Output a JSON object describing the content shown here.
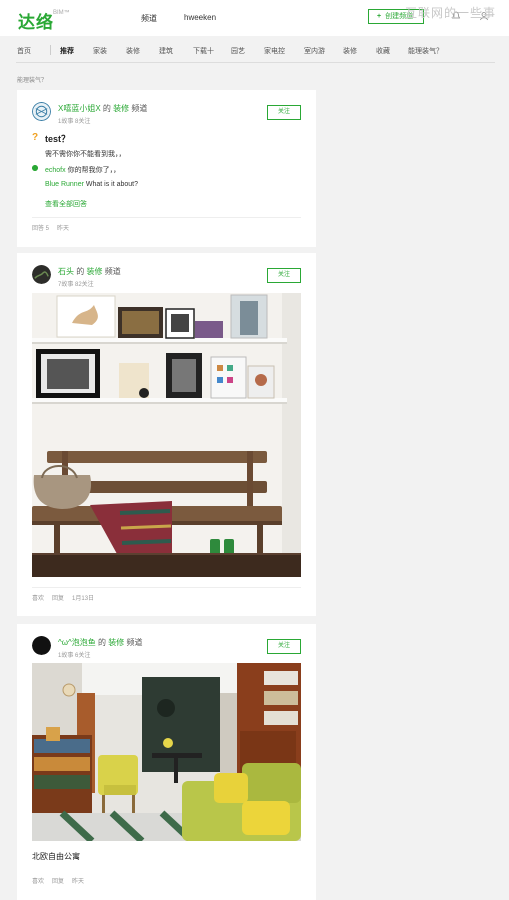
{
  "header": {
    "logo": "达络",
    "logo_sub": "BIM™",
    "nav": [
      "频道",
      "hweeken"
    ],
    "create_label": "创建频道",
    "watermark": "互联网的一些事"
  },
  "tabs": [
    "首页",
    "推荐",
    "家装",
    "装修",
    "建筑",
    "下载十",
    "园艺",
    "家电控",
    "室内游",
    "装修",
    "收藏",
    "能理装气？"
  ],
  "section_label": "能理装气？",
  "cards": [
    {
      "user": "X嘻蓝小姐X",
      "of": "的",
      "channel": "装修",
      "channel_suffix": "频道",
      "stats": "1故事 8关注",
      "follow": "关注",
      "question_mark": "?",
      "question": "test？",
      "question_body": "需不需你你不能看到我，，",
      "answer_user": "echofx",
      "answer_text": "你的帮我你了，，",
      "reply_user": "Blue Runner",
      "reply_text": "What is it about?",
      "view_all": "查看全部回答",
      "footer": [
        "回答 5",
        "昨天"
      ]
    },
    {
      "user": "石头",
      "of": "的",
      "channel": "装修",
      "channel_suffix": "频道",
      "stats": "7故事 82关注",
      "follow": "关注",
      "footer": [
        "喜欢",
        "回复",
        "1月13日"
      ]
    },
    {
      "user": "^ω^泡泡鱼",
      "of": "的",
      "channel": "装修",
      "channel_suffix": "频道",
      "stats": "1故事 6关注",
      "follow": "关注",
      "caption": "北欧自由公寓",
      "footer": [
        "喜欢",
        "回复",
        "昨天"
      ]
    }
  ],
  "colors": {
    "accent": "#2aa835",
    "question": "#f0a020"
  }
}
